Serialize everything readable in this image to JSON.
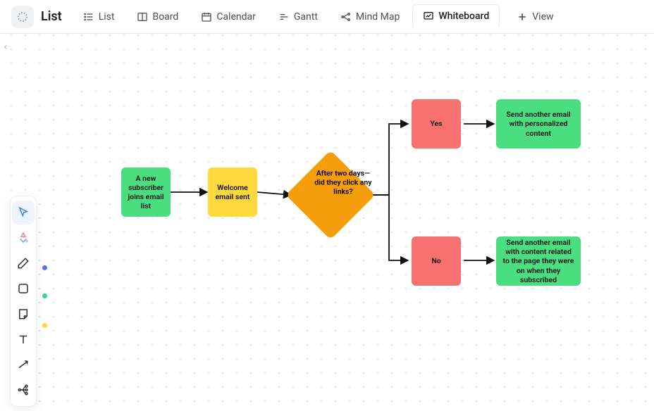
{
  "header": {
    "chip_label": "List",
    "tabs": [
      {
        "label": "List"
      },
      {
        "label": "Board"
      },
      {
        "label": "Calendar"
      },
      {
        "label": "Gantt"
      },
      {
        "label": "Mind Map"
      },
      {
        "label": "Whiteboard",
        "active": true
      }
    ],
    "add_view": "View"
  },
  "toolbox": {
    "items": [
      "cursor",
      "shapes-plus",
      "pen",
      "square",
      "sticky",
      "text",
      "connector",
      "graph"
    ],
    "dots": [
      {
        "color": "#5b6cff"
      },
      {
        "color": "#34d399"
      },
      {
        "color": "#fcd34d"
      }
    ]
  },
  "nodes": {
    "start": "A new subscriber joins email list",
    "welcome": "Welcome email sent",
    "decision": "After two days—did they click any links?",
    "yes": "Yes",
    "no": "No",
    "out_yes": "Send another email with personalized content",
    "out_no": "Send another email with content related to the page they were on when they subscribed"
  }
}
